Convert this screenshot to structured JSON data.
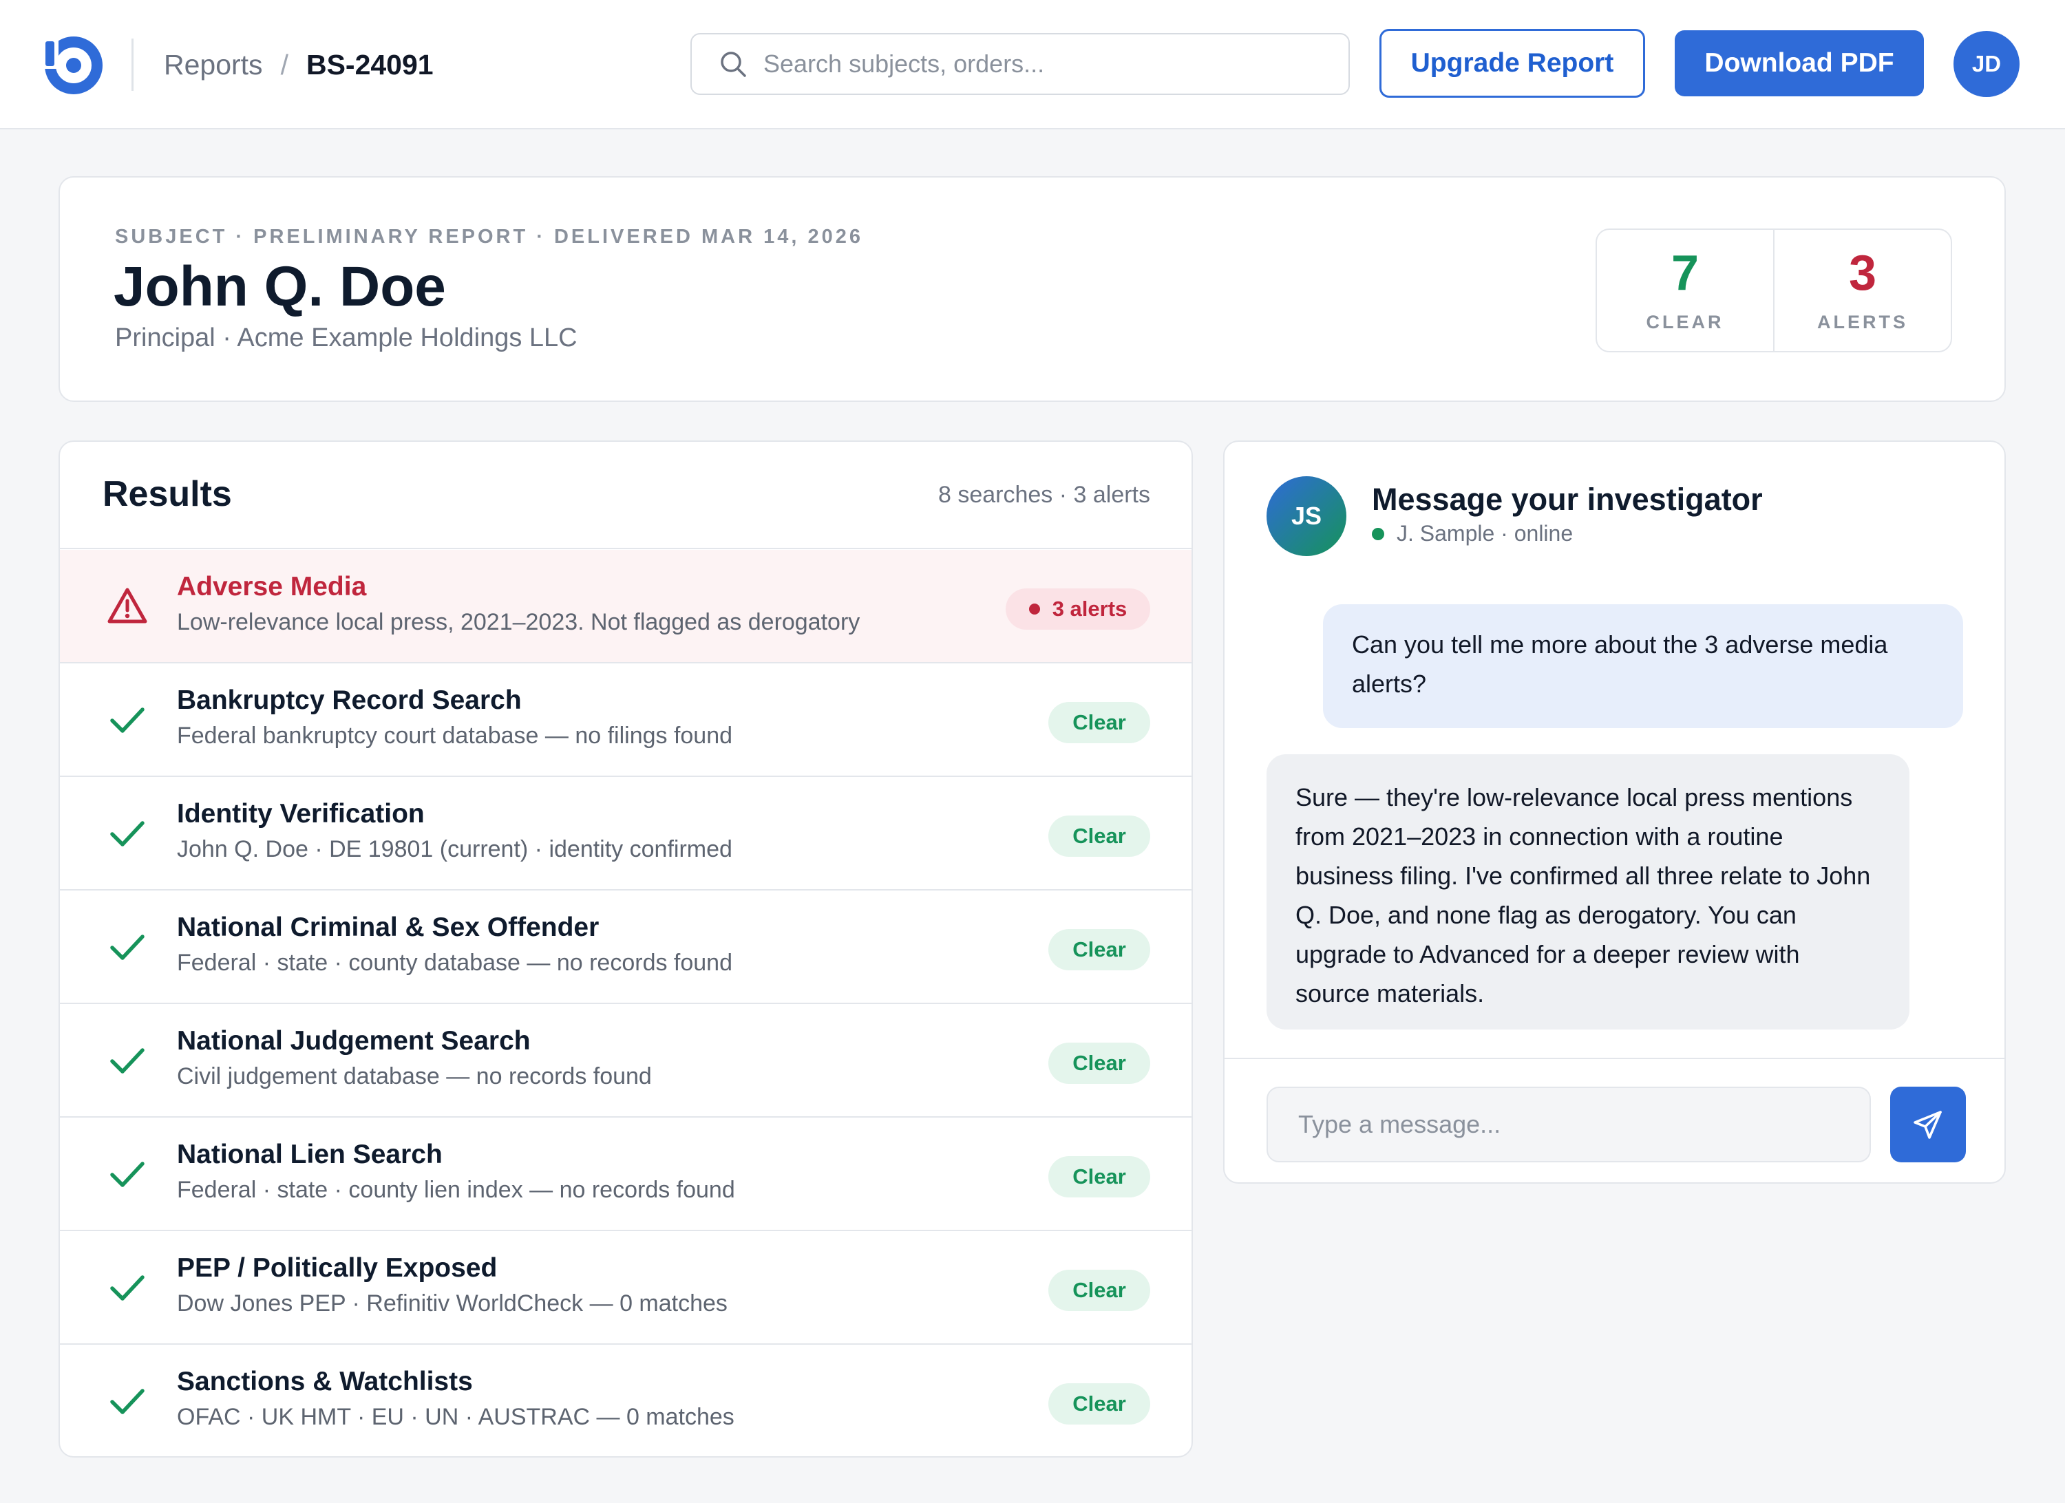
{
  "header": {
    "breadcrumb": {
      "parent": "Reports",
      "separator": "/",
      "current": "BS-24091"
    },
    "search_placeholder": "Search subjects, orders...",
    "upgrade_label": "Upgrade Report",
    "download_label": "Download PDF",
    "user_initials": "JD"
  },
  "subject": {
    "eyebrow": "SUBJECT · PRELIMINARY REPORT · DELIVERED MAR 14, 2026",
    "name": "John Q. Doe",
    "role": "Principal · Acme Example Holdings LLC",
    "stats": {
      "clear_count": "7",
      "clear_label": "CLEAR",
      "alerts_count": "3",
      "alerts_label": "ALERTS"
    }
  },
  "results": {
    "title": "Results",
    "meta": "8 searches · 3 alerts",
    "rows": [
      {
        "title": "Adverse Media",
        "desc": "Low-relevance local press, 2021–2023. Not flagged as derogatory",
        "status": "3 alerts",
        "icon": "warning-icon"
      },
      {
        "title": "Bankruptcy Record Search",
        "desc": "Federal bankruptcy court database — no filings found",
        "status": "Clear",
        "icon": "check-icon"
      },
      {
        "title": "Identity Verification",
        "desc": "John Q. Doe · DE 19801 (current) · identity confirmed",
        "status": "Clear",
        "icon": "check-icon"
      },
      {
        "title": "National Criminal & Sex Offender",
        "desc": "Federal · state · county database — no records found",
        "status": "Clear",
        "icon": "check-icon"
      },
      {
        "title": "National Judgement Search",
        "desc": "Civil judgement database — no records found",
        "status": "Clear",
        "icon": "check-icon"
      },
      {
        "title": "National Lien Search",
        "desc": "Federal · state · county lien index — no records found",
        "status": "Clear",
        "icon": "check-icon"
      },
      {
        "title": "PEP / Politically Exposed",
        "desc": "Dow Jones PEP · Refinitiv WorldCheck — 0 matches",
        "status": "Clear",
        "icon": "check-icon"
      },
      {
        "title": "Sanctions & Watchlists",
        "desc": "OFAC · UK HMT · EU · UN · AUSTRAC — 0 matches",
        "status": "Clear",
        "icon": "check-icon"
      }
    ]
  },
  "chat": {
    "avatar_initials": "JS",
    "title": "Message your investigator",
    "status": "J. Sample · online",
    "messages": [
      {
        "from": "user",
        "text": "Can you tell me more about the 3 adverse media alerts?"
      },
      {
        "from": "investigator",
        "text": "Sure — they're low-relevance local press mentions from 2021–2023 in connection with a routine business filing. I've confirmed all three relate to John Q. Doe, and none flag as derogatory. You can upgrade to Advanced for a deeper review with source materials."
      }
    ],
    "input_placeholder": "Type a message..."
  },
  "colors": {
    "brand": "#2f6bd8",
    "clear": "#16935a",
    "alert": "#c0263d"
  }
}
